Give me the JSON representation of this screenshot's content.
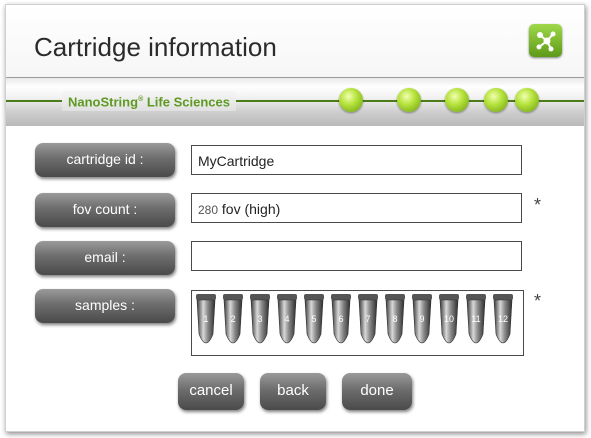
{
  "header": {
    "title": "Cartridge information",
    "app_icon": "network-icon",
    "brand": "NanoString",
    "brand_mark": "®",
    "brand_suffix": " Life Sciences",
    "progress_dots": 5,
    "accent_color": "#8dc63f"
  },
  "form": {
    "cartridge_id": {
      "label": "cartridge id :",
      "value": "MyCartridge"
    },
    "fov_count": {
      "label": "fov count :",
      "value_number": "280",
      "value_text": " fov (high)",
      "required_mark": "*"
    },
    "email": {
      "label": "email :",
      "value": ""
    },
    "samples": {
      "label": "samples :",
      "required_mark": "*",
      "tubes": [
        "1",
        "2",
        "3",
        "4",
        "5",
        "6",
        "7",
        "8",
        "9",
        "10",
        "11",
        "12"
      ]
    }
  },
  "actions": {
    "cancel": "cancel",
    "back": "back",
    "done": "done"
  }
}
